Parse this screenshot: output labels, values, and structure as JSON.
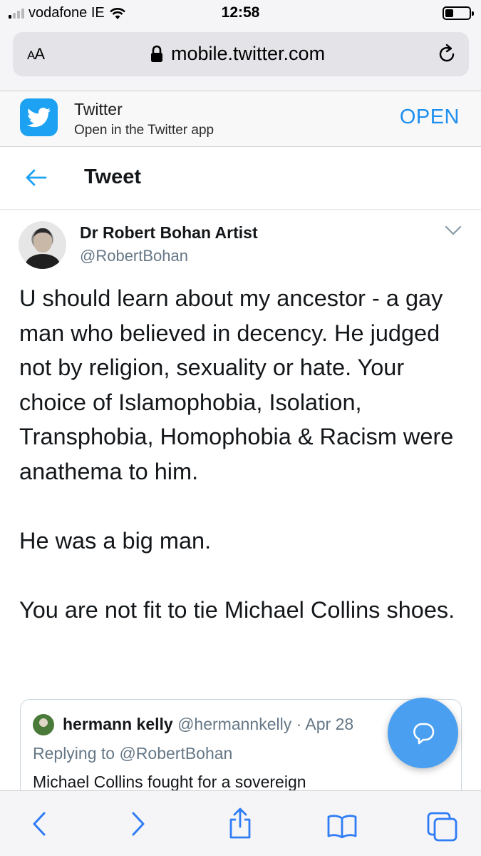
{
  "status_bar": {
    "carrier": "vodafone IE",
    "time": "12:58",
    "signal_bars_active": 1,
    "signal_bars_total": 4,
    "battery_level": 0.35
  },
  "browser": {
    "text_size_button": "AA",
    "url": "mobile.twitter.com",
    "lock_icon": "lock-icon",
    "reload_icon": "reload-icon"
  },
  "app_banner": {
    "app_name": "Twitter",
    "subtitle": "Open in the Twitter app",
    "open_label": "OPEN",
    "icon": "twitter-bird-icon"
  },
  "header": {
    "title": "Tweet",
    "back_icon": "back-arrow-icon"
  },
  "tweet": {
    "author_name": "Dr Robert Bohan Artist",
    "author_handle": "@RobertBohan",
    "paragraphs": [
      "U should learn about my ancestor - a gay man who believed in decency. He judged not by religion, sexuality or hate. Your choice of Islamophobia, Isolation, Transphobia, Homophobia & Racism were anathema to him.",
      "He was a big man.",
      "You are not fit to tie Michael Collins shoes."
    ],
    "quoted": {
      "name": "hermann kelly",
      "handle": "@hermannkelly",
      "separator": "·",
      "date": "Apr 28",
      "replying_to": "Replying to @RobertBohan",
      "text": "Michael Collins fought for a sovereign"
    }
  },
  "toolbar": {
    "items": [
      "back-icon",
      "forward-icon",
      "share-icon",
      "bookmarks-icon",
      "tabs-icon"
    ]
  },
  "colors": {
    "twitter_blue": "#1da1f2",
    "link_blue": "#1d8ff0",
    "ios_blue": "#2f7cf6",
    "fab_blue": "#4a9ff0",
    "muted_text": "#657786"
  }
}
